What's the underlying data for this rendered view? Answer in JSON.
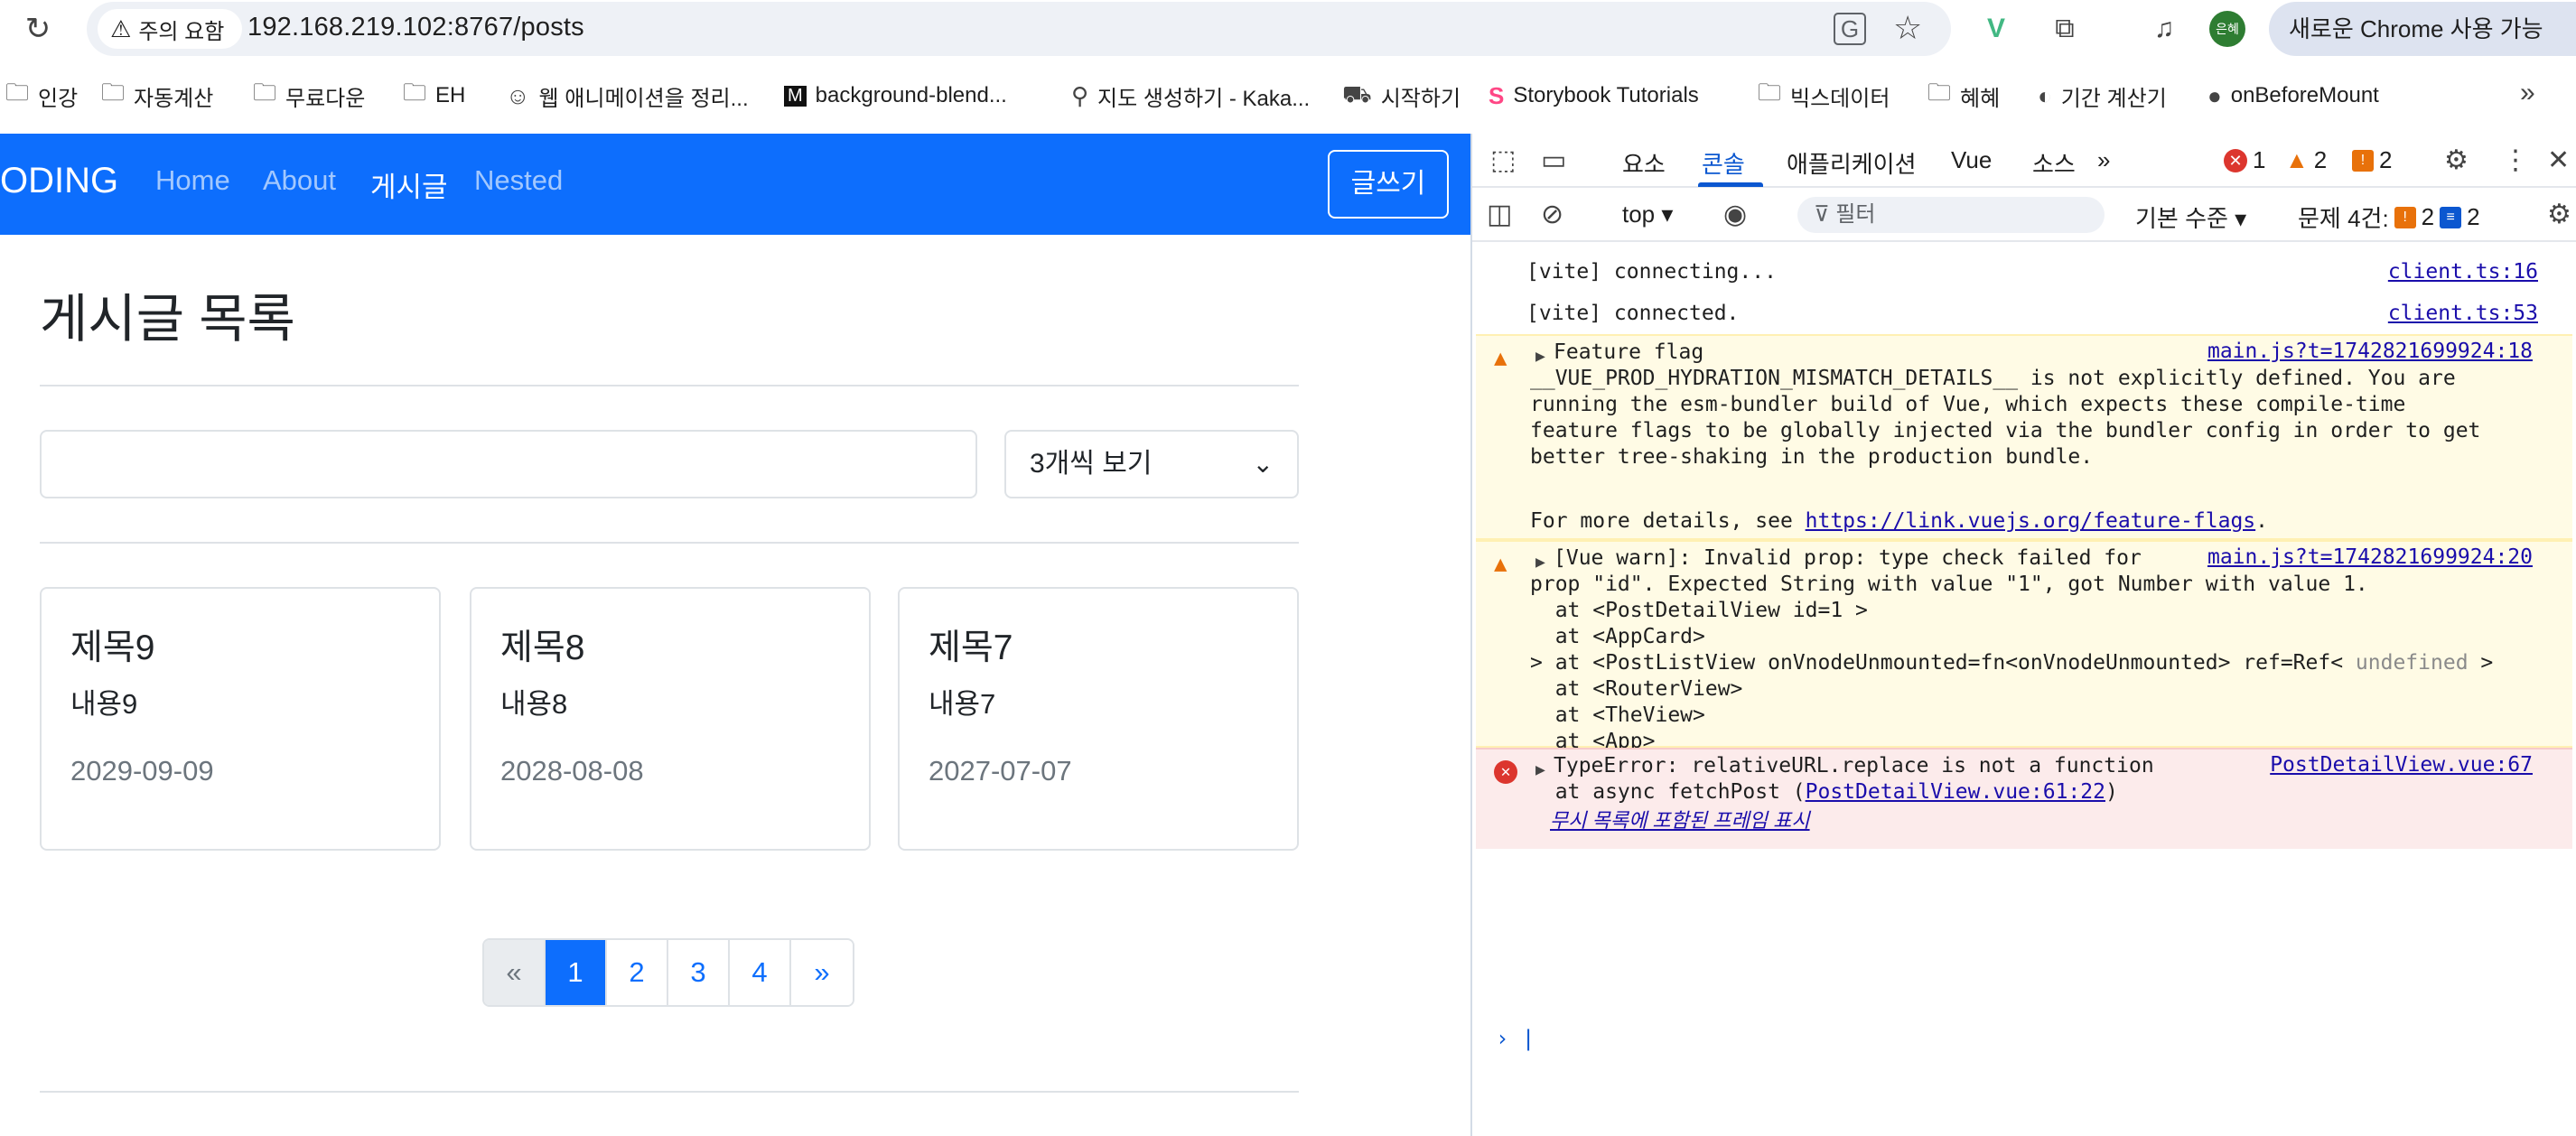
{
  "browser": {
    "security_label": "주의 요함",
    "url": "192.168.219.102:8767/posts",
    "update_label": "새로운 Chrome 사용 가능",
    "profile_label": "은혜"
  },
  "bookmarks": [
    {
      "label": "인강",
      "icon": "folder-icon"
    },
    {
      "label": "자동계산",
      "icon": "folder-icon"
    },
    {
      "label": "무료다운",
      "icon": "folder-icon"
    },
    {
      "label": "EH",
      "icon": "folder-icon"
    },
    {
      "label": "웹 애니메이션을 정리...",
      "icon": "mascot-icon"
    },
    {
      "label": "background-blend...",
      "icon": "mdn-icon"
    },
    {
      "label": "지도 생성하기 - Kaka...",
      "icon": "pin-icon"
    },
    {
      "label": "시작하기",
      "icon": "tractor-icon"
    },
    {
      "label": "Storybook Tutorials",
      "icon": "storybook-icon"
    },
    {
      "label": "빅스데이터",
      "icon": "folder-icon"
    },
    {
      "label": "혜혜",
      "icon": "folder-icon"
    },
    {
      "label": "기간 계산기",
      "icon": "globe-icon"
    },
    {
      "label": "onBeforeMount",
      "icon": "github-icon"
    }
  ],
  "app": {
    "brand": "ODING",
    "nav": [
      "Home",
      "About",
      "게시글",
      "Nested"
    ],
    "active_nav": "게시글",
    "write_button": "글쓰기",
    "page_title": "게시글 목록",
    "search_value": "",
    "page_size_label": "3개씩 보기",
    "posts": [
      {
        "title": "제목9",
        "content": "내용9",
        "date": "2029-09-09"
      },
      {
        "title": "제목8",
        "content": "내용8",
        "date": "2028-08-08"
      },
      {
        "title": "제목7",
        "content": "내용7",
        "date": "2027-07-07"
      }
    ],
    "pagination": {
      "prev": "«",
      "pages": [
        "1",
        "2",
        "3",
        "4"
      ],
      "next": "»",
      "active": "1"
    }
  },
  "devtools": {
    "tabs": [
      "요소",
      "콘솔",
      "애플리케이션",
      "Vue",
      "소스"
    ],
    "active_tab": "콘솔",
    "more_tabs": "»",
    "error_count": "1",
    "warning_count": "2",
    "issue_count": "2",
    "context": "top",
    "filter_placeholder": "필터",
    "log_level": "기본 수준",
    "issues_label": "문제 4건:",
    "issues_warn": "2",
    "issues_info": "2",
    "logs": [
      {
        "text": "[vite] connecting...",
        "source": "client.ts:16"
      },
      {
        "text": "[vite] connected.",
        "source": "client.ts:53"
      }
    ],
    "warning1": {
      "head": "Feature flag",
      "source": "main.js?t=1742821699924:18",
      "body": "__VUE_PROD_HYDRATION_MISMATCH_DETAILS__ is not explicitly defined. You are\nrunning the esm-bundler build of Vue, which expects these compile-time\nfeature flags to be globally injected via the bundler config in order to get\nbetter tree-shaking in the production bundle.",
      "more_prefix": "For more details, see ",
      "more_link": "https://link.vuejs.org/feature-flags",
      "more_suffix": "."
    },
    "warning2": {
      "head": "[Vue warn]: Invalid prop: type check failed for",
      "source": "main.js?t=1742821699924:20",
      "body": "prop \"id\". Expected String with value \"1\", got Number with value 1.\n  at <PostDetailView id=1 >\n  at <AppCard>\n  at <PostListView onVnodeUnmounted=fn<onVnodeUnmounted> ref=Ref< ",
      "body_gray": "undefined",
      "body_end": " >",
      "tail": ">\n  at <RouterView>\n  at <TheView>\n  at <App>"
    },
    "error1": {
      "head": "TypeError: relativeURL.replace is not a function",
      "source": "PostDetailView.vue:67",
      "stack_prefix": "  at async fetchPost (",
      "stack_link": "PostDetailView.vue:61:22",
      "stack_suffix": ")",
      "ignore_list": "무시 목록에 포함된 프레임 표시"
    }
  }
}
